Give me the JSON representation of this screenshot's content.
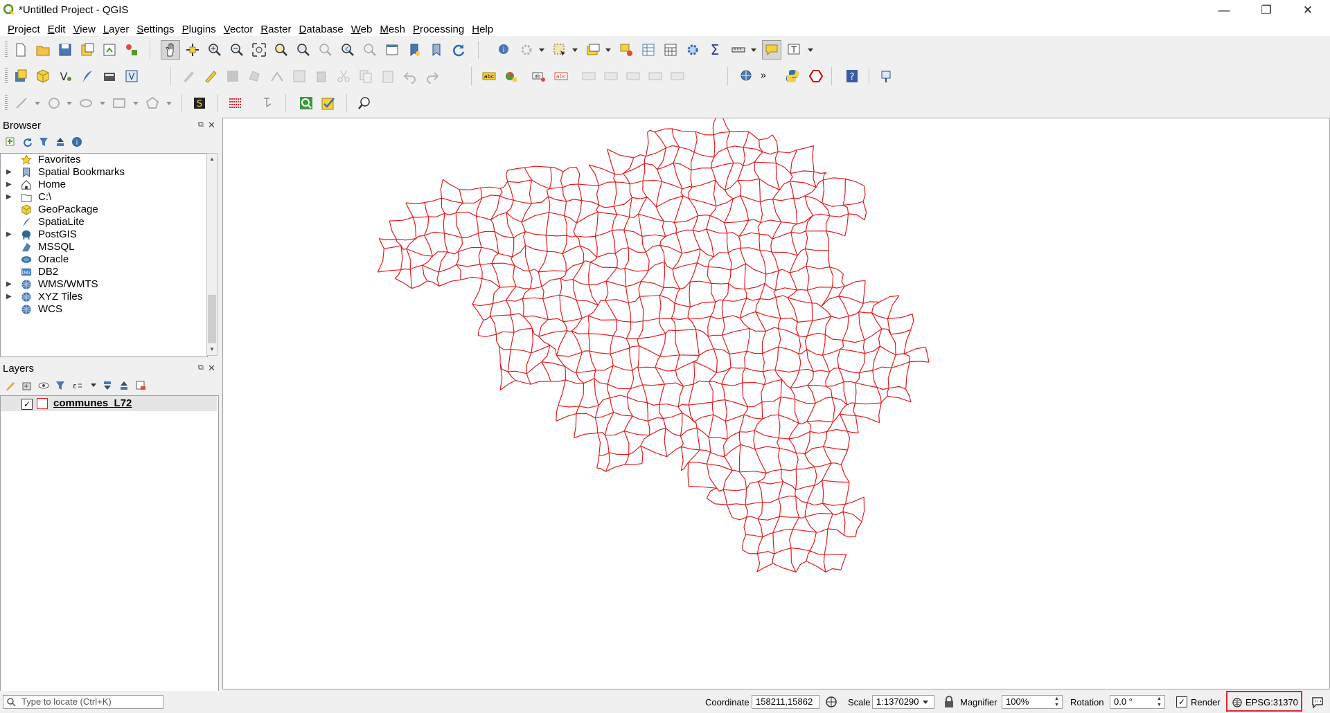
{
  "window": {
    "title": "*Untitled Project - QGIS",
    "minimize_glyph": "—",
    "restore_glyph": "❐",
    "close_glyph": "✕"
  },
  "menu": [
    {
      "label": "Project",
      "ul": "P",
      "rest": "roject"
    },
    {
      "label": "Edit",
      "ul": "E",
      "rest": "dit"
    },
    {
      "label": "View",
      "ul": "V",
      "rest": "iew"
    },
    {
      "label": "Layer",
      "ul": "L",
      "rest": "ayer"
    },
    {
      "label": "Settings",
      "ul": "S",
      "rest": "ettings"
    },
    {
      "label": "Plugins",
      "ul": "P",
      "rest": "lugins"
    },
    {
      "label": "Vector",
      "ul": "V",
      "rest": "ector"
    },
    {
      "label": "Raster",
      "ul": "R",
      "rest": "aster"
    },
    {
      "label": "Database",
      "ul": "D",
      "rest": "atabase"
    },
    {
      "label": "Web",
      "ul": "W",
      "rest": "eb"
    },
    {
      "label": "Mesh",
      "ul": "M",
      "rest": "esh"
    },
    {
      "label": "Processing",
      "ul": "P",
      "rest": "rocessing"
    },
    {
      "label": "Help",
      "ul": "H",
      "rest": "elp"
    }
  ],
  "browser": {
    "title": "Browser",
    "items": [
      {
        "label": "Favorites",
        "icon": "star-icon",
        "expandable": false
      },
      {
        "label": "Spatial Bookmarks",
        "icon": "bookmark-icon",
        "expandable": true
      },
      {
        "label": "Home",
        "icon": "home-icon",
        "expandable": true
      },
      {
        "label": "C:\\",
        "icon": "folder-icon",
        "expandable": true
      },
      {
        "label": "GeoPackage",
        "icon": "geopackage-icon",
        "expandable": false
      },
      {
        "label": "SpatiaLite",
        "icon": "spatialite-icon",
        "expandable": false
      },
      {
        "label": "PostGIS",
        "icon": "postgis-icon",
        "expandable": true
      },
      {
        "label": "MSSQL",
        "icon": "mssql-icon",
        "expandable": false
      },
      {
        "label": "Oracle",
        "icon": "oracle-icon",
        "expandable": false
      },
      {
        "label": "DB2",
        "icon": "db2-icon",
        "expandable": false
      },
      {
        "label": "WMS/WMTS",
        "icon": "globe-icon",
        "expandable": true
      },
      {
        "label": "XYZ Tiles",
        "icon": "globe-icon",
        "expandable": true
      },
      {
        "label": "WCS",
        "icon": "globe-icon",
        "expandable": false
      }
    ],
    "db2_badge": "DB2"
  },
  "layers": {
    "title": "Layers",
    "items": [
      {
        "label": "communes_L72",
        "checked": true,
        "fill": "#ffffff",
        "stroke": "#e31a1c"
      }
    ]
  },
  "map": {
    "stroke_color": "#e31a1c",
    "background": "#ffffff"
  },
  "status": {
    "locator_placeholder": "Type to locate (Ctrl+K)",
    "coordinate_label": "Coordinate",
    "coordinate_value": "158211,15862",
    "scale_label": "Scale",
    "scale_value": "1:1370290",
    "magnifier_label": "Magnifier",
    "magnifier_value": "100%",
    "rotation_label": "Rotation",
    "rotation_value": "0.0 °",
    "render_label": "Render",
    "render_checked": true,
    "crs_label": "EPSG:31370",
    "highlight_color": "#e0262b"
  },
  "colors": {
    "accent_green": "#589632",
    "selection_yellow": "#f5d142"
  }
}
